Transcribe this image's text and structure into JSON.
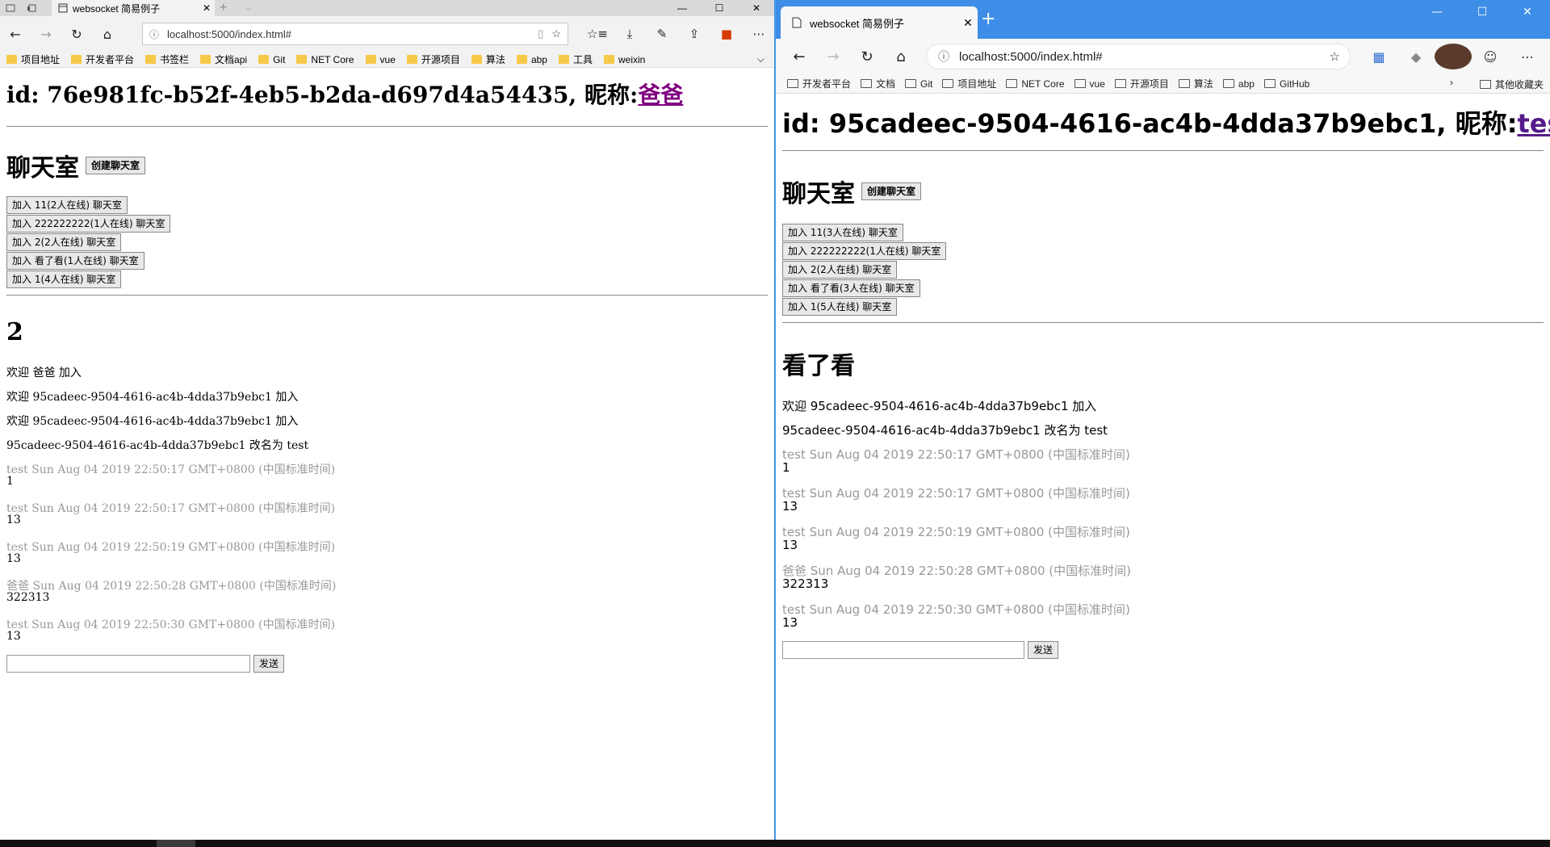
{
  "left": {
    "tab_title": "websocket 简易例子",
    "url": "localhost:5000/index.html#",
    "favorites": [
      "项目地址",
      "开发者平台",
      "书签栏",
      "文档api",
      "Git",
      "NET Core",
      "vue",
      "开源项目",
      "算法",
      "abp",
      "工具",
      "weixin"
    ],
    "user": {
      "id_label": "id: 76e981fc-b52f-4eb5-b2da-d697d4a54435,",
      "nick_label": "昵称:",
      "nick": "爸爸"
    },
    "chat_title": "聊天室",
    "create_btn": "创建聊天室",
    "rooms": [
      "加入 11(2人在线) 聊天室",
      "加入 222222222(1人在线) 聊天室",
      "加入 2(2人在线) 聊天室",
      "加入 看了看(1人在线) 聊天室",
      "加入 1(4人在线) 聊天室"
    ],
    "current_room": "2",
    "system_messages": [
      "欢迎 爸爸 加入",
      "欢迎 95cadeec-9504-4616-ac4b-4dda37b9ebc1 加入",
      "欢迎 95cadeec-9504-4616-ac4b-4dda37b9ebc1 加入",
      "95cadeec-9504-4616-ac4b-4dda37b9ebc1 改名为 test"
    ],
    "messages": [
      {
        "meta": "test Sun Aug 04 2019 22:50:17 GMT+0800 (中国标准时间)",
        "text": "1"
      },
      {
        "meta": "test Sun Aug 04 2019 22:50:17 GMT+0800 (中国标准时间)",
        "text": "13"
      },
      {
        "meta": "test Sun Aug 04 2019 22:50:19 GMT+0800 (中国标准时间)",
        "text": "13"
      },
      {
        "meta": "爸爸 Sun Aug 04 2019 22:50:28 GMT+0800 (中国标准时间)",
        "text": "322313"
      },
      {
        "meta": "test Sun Aug 04 2019 22:50:30 GMT+0800 (中国标准时间)",
        "text": "13"
      }
    ],
    "send_btn": "发送"
  },
  "right": {
    "tab_title": "websocket 简易例子",
    "url": "localhost:5000/index.html#",
    "favorites": [
      "开发者平台",
      "文档",
      "Git",
      "项目地址",
      "NET Core",
      "vue",
      "开源项目",
      "算法",
      "abp",
      "GitHub"
    ],
    "other_favorites": "其他收藏夹",
    "user": {
      "id_label": "id: 95cadeec-9504-4616-ac4b-4dda37b9ebc1,",
      "nick_label": "昵称:",
      "nick": "test"
    },
    "chat_title": "聊天室",
    "create_btn": "创建聊天室",
    "rooms": [
      "加入 11(3人在线) 聊天室",
      "加入 222222222(1人在线) 聊天室",
      "加入 2(2人在线) 聊天室",
      "加入 看了看(3人在线) 聊天室",
      "加入 1(5人在线) 聊天室"
    ],
    "current_room": "看了看",
    "system_messages": [
      "欢迎 95cadeec-9504-4616-ac4b-4dda37b9ebc1 加入",
      "95cadeec-9504-4616-ac4b-4dda37b9ebc1 改名为 test"
    ],
    "messages": [
      {
        "meta": "test Sun Aug 04 2019 22:50:17 GMT+0800 (中国标准时间)",
        "text": "1"
      },
      {
        "meta": "test Sun Aug 04 2019 22:50:17 GMT+0800 (中国标准时间)",
        "text": "13"
      },
      {
        "meta": "test Sun Aug 04 2019 22:50:19 GMT+0800 (中国标准时间)",
        "text": "13"
      },
      {
        "meta": "爸爸 Sun Aug 04 2019 22:50:28 GMT+0800 (中国标准时间)",
        "text": "322313"
      },
      {
        "meta": "test Sun Aug 04 2019 22:50:30 GMT+0800 (中国标准时间)",
        "text": "13"
      }
    ],
    "send_btn": "发送"
  },
  "colors": {
    "right_titlebar": "#3e8ee8",
    "visited_link": "#800080",
    "meta_text": "#999999"
  },
  "icons": [
    "back-icon",
    "forward-icon",
    "refresh-icon",
    "home-icon",
    "star-icon",
    "download-icon",
    "pen-icon",
    "share-icon",
    "more-icon",
    "info-icon",
    "folder-icon",
    "close-icon"
  ]
}
